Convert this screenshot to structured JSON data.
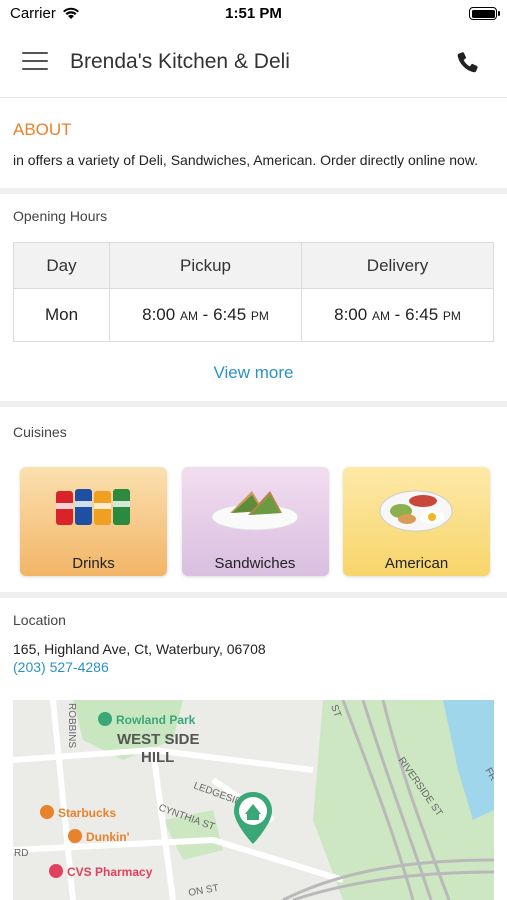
{
  "status": {
    "carrier": "Carrier",
    "time": "1:51 PM"
  },
  "header": {
    "title": "Brenda's Kitchen & Deli"
  },
  "about": {
    "heading": "ABOUT",
    "description": "in  offers a variety of Deli, Sandwiches, American. Order directly online now."
  },
  "hours": {
    "title": "Opening Hours",
    "columns": [
      "Day",
      "Pickup",
      "Delivery"
    ],
    "rows": [
      {
        "day": "Mon",
        "pickup_open": "8:00",
        "pickup_open_ampm": "AM",
        "pickup_close": "6:45",
        "pickup_close_ampm": "PM",
        "delivery_open": "8:00",
        "delivery_open_ampm": "AM",
        "delivery_close": "6:45",
        "delivery_close_ampm": "PM"
      }
    ],
    "view_more": "View more"
  },
  "cuisines": {
    "title": "Cuisines",
    "items": [
      {
        "label": "Drinks",
        "icon": "soda-cans-icon"
      },
      {
        "label": "Sandwiches",
        "icon": "sandwich-plate-icon"
      },
      {
        "label": "American",
        "icon": "breakfast-plate-icon"
      }
    ]
  },
  "location": {
    "title": "Location",
    "address": "165, Highland Ave, Ct, Waterbury, 06708",
    "phone": "(203) 527-4286",
    "map": {
      "labels": {
        "park": "Rowland Park",
        "district_line1": "WEST SIDE",
        "district_line2": "HILL",
        "starbucks": "Starbucks",
        "dunkin": "Dunkin'",
        "cvs": "CVS Pharmacy",
        "ledgeside": "LEDGESID",
        "cynthia": "CYNTHIA ST",
        "robbins": "ROBBINS",
        "riverside": "RIVERSIDE ST",
        "st_top": "ST",
        "rd": "RD",
        "on_st": "ON ST",
        "fr": "FR"
      }
    }
  },
  "colors": {
    "accent": "#e8822b",
    "link": "#2a93c4",
    "map_pin": "#3aa776"
  }
}
